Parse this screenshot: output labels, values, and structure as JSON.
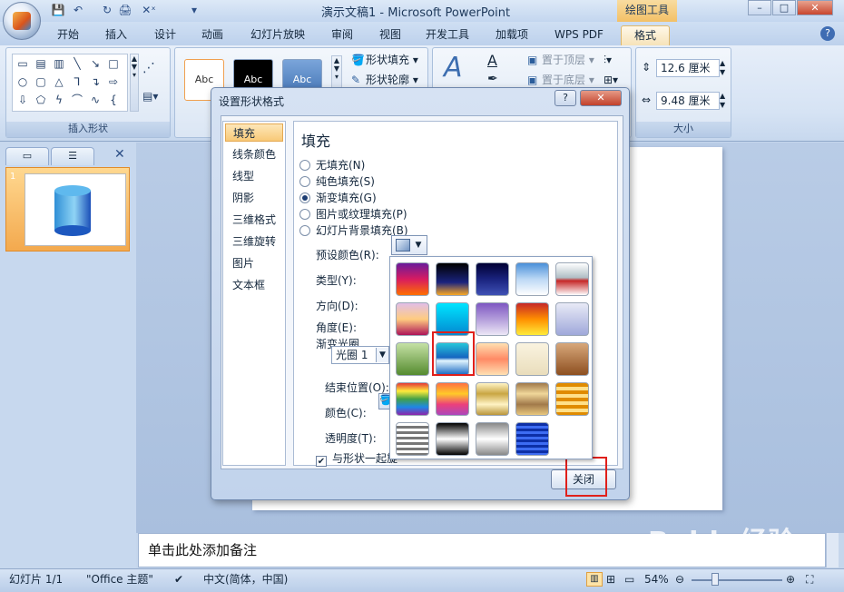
{
  "titlebar": {
    "title": "演示文稿1 - Microsoft PowerPoint",
    "context_tab": "绘图工具",
    "min": "–",
    "max": "□",
    "close": "✕"
  },
  "qat": {
    "save": "💾",
    "undo": "↶",
    "redo": "↻",
    "print": "🖨",
    "quick": "✕ˣ",
    "more": "▾"
  },
  "tabs": [
    "开始",
    "插入",
    "设计",
    "动画",
    "幻灯片放映",
    "审阅",
    "视图",
    "开发工具",
    "加载项",
    "WPS PDF",
    "格式"
  ],
  "ribbon": {
    "insert_shapes_label": "插入形状",
    "style_sample": "Abc",
    "shape_fill": "形状填充",
    "shape_outline": "形状轮廓",
    "bring_front": "置于顶层",
    "send_back": "置于底层",
    "height": "12.6 厘米",
    "width": "9.48 厘米",
    "size_label": "大小",
    "help": "?"
  },
  "dialog": {
    "title": "设置形状格式",
    "help": "?",
    "close": "✕",
    "nav": [
      "填充",
      "线条颜色",
      "线型",
      "阴影",
      "三维格式",
      "三维旋转",
      "图片",
      "文本框"
    ],
    "heading": "填充",
    "options": [
      "无填充(N)",
      "纯色填充(S)",
      "渐变填充(G)",
      "图片或纹理填充(P)",
      "幻灯片背景填充(B)"
    ],
    "preset_label": "预设颜色(R):",
    "type_label": "类型(Y):",
    "direction_label": "方向(D):",
    "angle_label": "角度(E):",
    "stops_label": "渐变光圈",
    "stop_value": "光圈 1",
    "end_pos_label": "结束位置(O):",
    "color_label": "颜色(C):",
    "transparency_label": "透明度(T):",
    "rotate_label": "与形状一起旋",
    "close_button": "关闭"
  },
  "notes": {
    "placeholder": "单击此处添加备注"
  },
  "status": {
    "slide": "幻灯片 1/1",
    "theme": "\"Office 主题\"",
    "lang": "中文(简体，中国)",
    "zoom": "54%"
  },
  "watermark": {
    "brand": "Baidu经验",
    "url": "jingyan.baidu.com"
  },
  "gallery": {
    "selected_index": 6,
    "presets": [
      "linear-gradient(#6a1b9a,#d81b60,#ff6f00)",
      "linear-gradient(#000,#1a237e 60%,#f9a825)",
      "linear-gradient(#000033,#1a237e,#3f51b5)",
      "linear-gradient(#4a90d9,#bcd8f5,#fff)",
      "linear-gradient(#fff,#b0bec5 45%,#c62828 55%,#fff)",
      "linear-gradient(#e1bee7,#ffcc80,#ad1457)",
      "linear-gradient(#00e5ff,#0288d1)",
      "linear-gradient(#7e57c2,#b39ddb,#ede7f6)",
      "linear-gradient(#c62828,#ff8f00,#ffeb3b)",
      "linear-gradient(#e8eaf6,#9fa8da)",
      "linear-gradient(#c5e1a5,#558b2f)",
      "linear-gradient(#26c6da,#1565c0 45%,#e1f5fe 55%,#1565c0)",
      "linear-gradient(#ffe0b2,#ff8a65,#ffe0b2)",
      "linear-gradient(#faf3e0,#e9ddbb)",
      "linear-gradient(#d7a77a,#8d4f20)",
      "linear-gradient(#e53935,#ffeb3b,#43a047,#1e88e5,#8e24aa)",
      "linear-gradient(#ff7043,#ffca28,#ec407a,#ab47bc)",
      "linear-gradient(#fff3c4,#c9a643,#fff3c4,#b9953a)",
      "linear-gradient(#a1794a,#f0d79a,#a1794a,#e8c77d)",
      "repeating-linear-gradient(#e08b00 0 4px,#ffe08a 4px 8px)",
      "repeating-linear-gradient(#fff 0 3px,#777 3px 6px)",
      "linear-gradient(#000,#fff 50%,#000)",
      "linear-gradient(#888,#fff 50%,#888)",
      "repeating-linear-gradient(#0d2fa6 0 3px,#3d6cf2 3px 6px)"
    ]
  }
}
